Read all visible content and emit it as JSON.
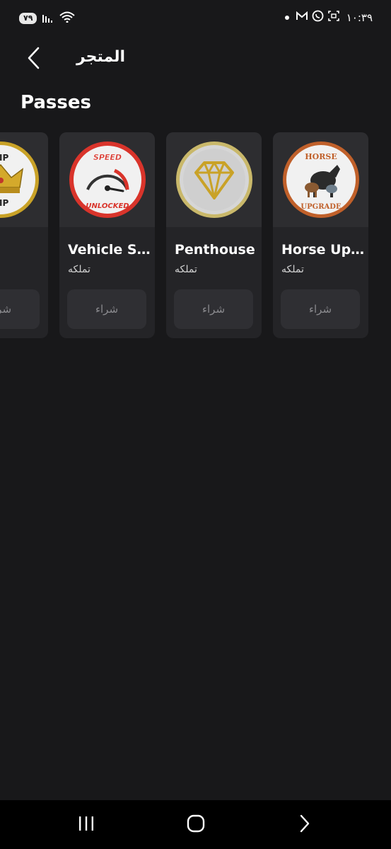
{
  "status_bar": {
    "battery": "٧٩",
    "time": "١٠:٣٩",
    "icons": [
      "signal-icon",
      "wifi-icon",
      "notification-dot",
      "gmail-icon",
      "whatsapp-icon",
      "screenshot-icon"
    ]
  },
  "app_bar": {
    "title": "المتجر",
    "back_icon": "chevron-left-icon"
  },
  "section": {
    "title": "Passes"
  },
  "passes": [
    {
      "name": "",
      "image": "crown-vip-badge",
      "subtitle": "",
      "buy_label": "شراء"
    },
    {
      "name": "Vehicle S...",
      "image": "speed-unlocked-badge",
      "subtitle": "تملكه",
      "buy_label": "شراء"
    },
    {
      "name": "Penthouse",
      "image": "gold-diamond-badge",
      "subtitle": "تملكه",
      "buy_label": "شراء"
    },
    {
      "name": "Horse Up...",
      "image": "horse-upgrade-badge",
      "subtitle": "تملكه",
      "buy_label": "شراء"
    }
  ],
  "badge_text": {
    "speed_top": "SPEED",
    "speed_bottom": "UNLOCKED",
    "horse_top": "HORSE",
    "horse_bottom": "UPGRADE",
    "vip_top": "VIP",
    "vip_bottom": "VIP"
  },
  "nav_bar": {
    "icons": [
      "recent-apps-icon",
      "home-icon",
      "back-icon"
    ]
  },
  "colors": {
    "background": "#18181a",
    "card": "#242427",
    "button": "#2f2f33",
    "speed_red": "#d9342b",
    "gold": "#c9a227",
    "horse_orange": "#c0602a"
  }
}
